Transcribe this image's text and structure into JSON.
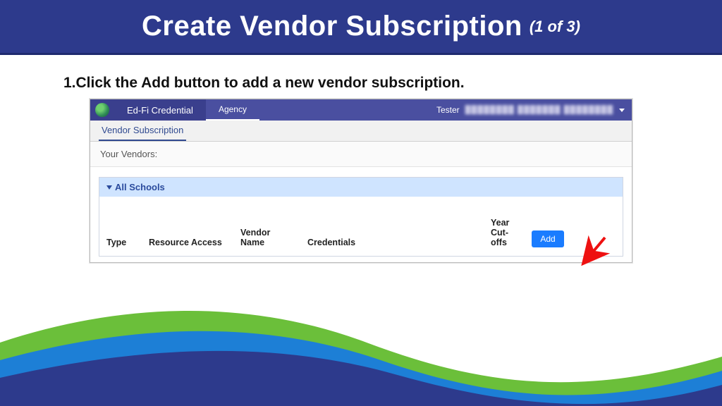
{
  "header": {
    "title": "Create Vendor Subscription",
    "step_label": "(1 of 3)"
  },
  "instruction": "1.Click the Add button to add a new vendor subscription.",
  "app": {
    "brand": "Ed-Fi Credential",
    "agency_tab": "Agency",
    "user_role": "Tester",
    "user_detail": "████████ ███████ ████████",
    "page_tab": "Vendor Subscription",
    "your_vendors_label": "Your Vendors:",
    "panel_title": "All Schools",
    "columns": {
      "type": "Type",
      "resource_access": "Resource Access",
      "vendor_name": "Vendor Name",
      "credentials": "Credentials",
      "year_cutoffs": "Year Cut-offs"
    },
    "add_button_label": "Add"
  }
}
